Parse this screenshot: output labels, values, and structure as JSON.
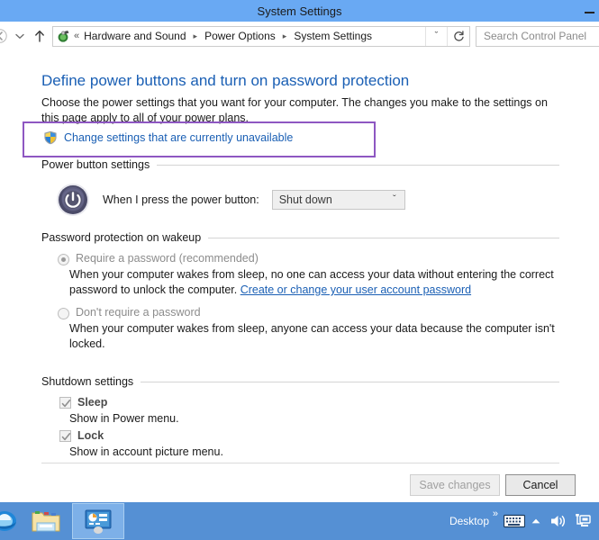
{
  "window": {
    "title": "System Settings",
    "minimize_label": "minimize"
  },
  "navbar": {
    "back_icon": "back-arrow-icon",
    "recent_icon": "recent-pages-chevron-icon",
    "up_icon": "up-arrow-icon",
    "address_icon": "control-panel-icon",
    "overflow": "«",
    "breadcrumbs": [
      {
        "label": "Hardware and Sound"
      },
      {
        "label": "Power Options"
      },
      {
        "label": "System Settings"
      }
    ],
    "separator": "▸",
    "dropdown_caret": "ˇ",
    "refresh_icon": "refresh-icon",
    "search": {
      "placeholder": "Search Control Panel",
      "value": ""
    }
  },
  "main": {
    "page_title": "Define power buttons and turn on password protection",
    "page_description": "Choose the power settings that you want for your computer. The changes you make to the settings on this page apply to all of your power plans.",
    "uac": {
      "icon": "uac-shield-icon",
      "link_text": "Change settings that are currently unavailable",
      "highlight_color": "#8e57c2"
    },
    "power_button_section": {
      "group_label": "Power button settings",
      "icon": "power-button-icon",
      "field_label": "When I press the power button:",
      "dropdown_value": "Shut down",
      "dropdown_caret": "ˇ"
    },
    "password_section": {
      "group_label": "Password protection on wakeup",
      "options": [
        {
          "label": "Require a password (recommended)",
          "selected": true,
          "description_before": "When your computer wakes from sleep, no one can access your data without entering the correct password to unlock the computer. ",
          "description_link": "Create or change your user account password"
        },
        {
          "label": "Don't require a password",
          "selected": false,
          "description_before": "When your computer wakes from sleep, anyone can access your data because the computer isn't locked.",
          "description_link": ""
        }
      ]
    },
    "shutdown_section": {
      "group_label": "Shutdown settings",
      "items": [
        {
          "label": "Sleep",
          "checked": true,
          "description": "Show in Power menu."
        },
        {
          "label": "Lock",
          "checked": true,
          "description": "Show in account picture menu."
        }
      ]
    },
    "footer": {
      "save_label": "Save changes",
      "save_disabled": true,
      "cancel_label": "Cancel"
    }
  },
  "taskbar": {
    "buttons": [
      {
        "name": "internet-explorer",
        "active": false
      },
      {
        "name": "file-explorer",
        "active": false
      },
      {
        "name": "control-panel",
        "active": true
      }
    ],
    "tray": {
      "desktop_label": "Desktop",
      "overflow_chevron": "»",
      "icons": [
        {
          "name": "on-screen-keyboard-icon"
        },
        {
          "name": "show-hidden-icons-chevron"
        },
        {
          "name": "volume-icon"
        },
        {
          "name": "network-icon"
        }
      ]
    }
  }
}
